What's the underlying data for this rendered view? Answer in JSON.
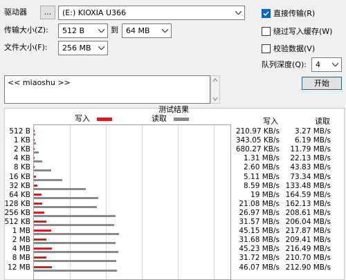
{
  "drive": {
    "label": "驱动器",
    "browse_label": "...",
    "value": "(E:) KIOXIA U366"
  },
  "transfer_size": {
    "label": "传输大小(Z):",
    "from": "512 B",
    "to_label": "到",
    "to": "64 MB"
  },
  "file_size": {
    "label": "文件大小(F):",
    "value": "256 MB"
  },
  "options": {
    "direct_io": {
      "label": "直接传输(R)",
      "checked": true
    },
    "bypass_cache": {
      "label": "绕过写入缓存(W)",
      "checked": false
    },
    "verify": {
      "label": "校验数据(V)",
      "checked": false
    },
    "queue_depth_label": "队列深度(Q):",
    "queue_depth": "4",
    "start_label": "开始"
  },
  "description_text": "<< miaoshu >>",
  "results": {
    "title": "测试结果",
    "legend_write": "写入",
    "legend_read": "读取",
    "col_write": "写入",
    "col_read": "读取"
  },
  "colors": {
    "write": "#d02020",
    "read": "#888888",
    "checkbox_on": "#0067c0"
  },
  "chart_data": {
    "type": "bar",
    "orientation": "horizontal",
    "title": "测试结果",
    "categories": [
      "512 B",
      "1 KB",
      "2 KB",
      "4 KB",
      "8 KB",
      "16 KB",
      "32 KB",
      "64 KB",
      "128 KB",
      "256 KB",
      "512 KB",
      "1 MB",
      "2 MB",
      "4 MB",
      "8 MB",
      "12 MB"
    ],
    "series": [
      {
        "name": "写入",
        "unit": "MB/s",
        "values": [
          0.21097,
          0.34305,
          0.68027,
          1.31,
          2.6,
          5.11,
          8.59,
          19,
          21.08,
          26.97,
          31.57,
          45.15,
          31.68,
          45.23,
          31.72,
          46.07
        ]
      },
      {
        "name": "读取",
        "unit": "MB/s",
        "values": [
          3.27,
          6.19,
          11.79,
          22.13,
          43.83,
          73.34,
          133.48,
          164.59,
          162.13,
          208.61,
          206.04,
          217.87,
          209.41,
          216.49,
          210.7,
          212.9
        ]
      }
    ],
    "write_labels": [
      "210.97 KB/s",
      "343.05 KB/s",
      "680.27 KB/s",
      "1.31 MB/s",
      "2.60 MB/s",
      "5.11 MB/s",
      "8.59 MB/s",
      "19 MB/s",
      "21.08 MB/s",
      "26.97 MB/s",
      "31.57 MB/s",
      "45.15 MB/s",
      "31.68 MB/s",
      "45.23 MB/s",
      "31.72 MB/s",
      "46.07 MB/s"
    ],
    "read_labels": [
      "3.27 MB/s",
      "6.19 MB/s",
      "11.79 MB/s",
      "22.13 MB/s",
      "43.83 MB/s",
      "73.34 MB/s",
      "133.48 MB/s",
      "164.59 MB/s",
      "162.13 MB/s",
      "208.61 MB/s",
      "206.04 MB/s",
      "217.87 MB/s",
      "209.41 MB/s",
      "216.49 MB/s",
      "210.70 MB/s",
      "212.90 MB/s"
    ],
    "xlim": [
      0,
      500
    ],
    "grid": true,
    "legend": "top"
  }
}
